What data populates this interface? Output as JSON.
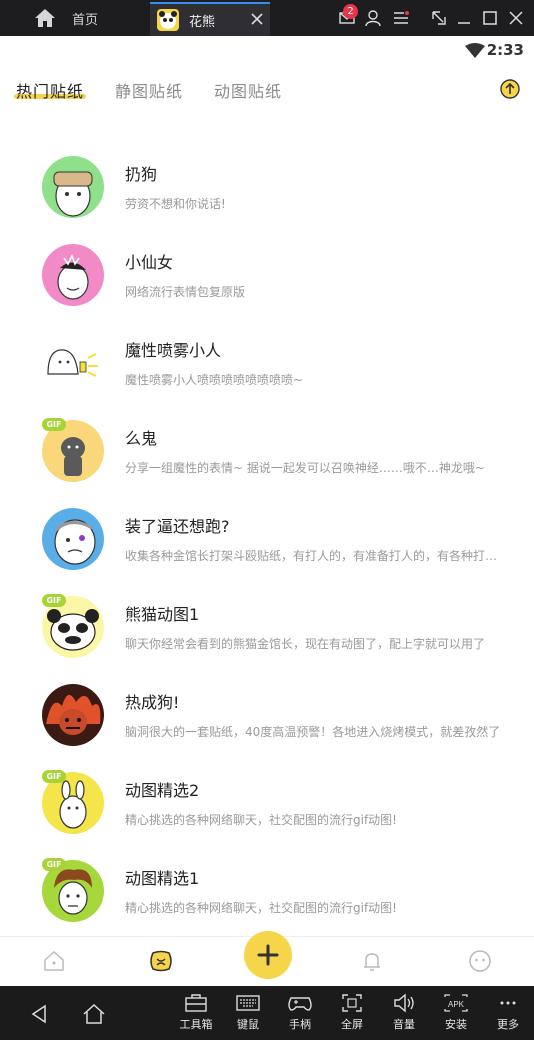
{
  "titlebar": {
    "home_label": "首页",
    "tab_label": "花熊",
    "mail_badge": "2"
  },
  "status": {
    "time": "2:33"
  },
  "tabs": [
    {
      "label": "热门贴纸",
      "active": true
    },
    {
      "label": "静图贴纸",
      "active": false
    },
    {
      "label": "动图贴纸",
      "active": false
    }
  ],
  "items": [
    {
      "name": "扔狗",
      "desc": "劳资不想和你说话!",
      "gif": false,
      "bg": "#8fe08a"
    },
    {
      "name": "小仙女",
      "desc": "网络流行表情包复原版",
      "gif": false,
      "bg": "#f28ac8"
    },
    {
      "name": "魔性喷雾小人",
      "desc": "魔性喷雾小人喷喷喷喷喷喷喷喷~",
      "gif": false,
      "bg": "#ffffff"
    },
    {
      "name": "么鬼",
      "desc": "分享一组魔性的表情~ 据说一起发可以召唤神经……哦不…神龙哦~",
      "gif": true,
      "gif_label": "GIF",
      "bg": "#f9d77a"
    },
    {
      "name": "装了逼还想跑?",
      "desc": "收集各种金馆长打架斗殴贴纸，有打人的，有准备打人的，有各种打人的",
      "gif": false,
      "bg": "#5aaee8"
    },
    {
      "name": "熊猫动图1",
      "desc": "聊天你经常会看到的熊猫金馆长，现在有动图了，配上字就可以用了",
      "gif": true,
      "gif_label": "GIF",
      "bg": "#fbf7a6"
    },
    {
      "name": "热成狗!",
      "desc": "脑洞很大的一套贴纸，40度高温预警！各地进入烧烤模式，就差孜然了",
      "gif": false,
      "bg": "#3a1a12"
    },
    {
      "name": "动图精选2",
      "desc": "精心挑选的各种网络聊天，社交配图的流行gif动图!",
      "gif": true,
      "gif_label": "GIF",
      "bg": "#f4e54a"
    },
    {
      "name": "动图精选1",
      "desc": "精心挑选的各种网络聊天，社交配图的流行gif动图!",
      "gif": true,
      "gif_label": "GIF",
      "bg": "#a6d83c"
    }
  ],
  "sysbar": {
    "items": [
      {
        "label": "工具箱",
        "icon": "toolbox-icon"
      },
      {
        "label": "键鼠",
        "icon": "keyboard-icon"
      },
      {
        "label": "手柄",
        "icon": "gamepad-icon"
      },
      {
        "label": "全屏",
        "icon": "fullscreen-icon"
      },
      {
        "label": "音量",
        "icon": "volume-icon"
      },
      {
        "label": "安装",
        "icon": "apk-install-icon"
      },
      {
        "label": "更多",
        "icon": "more-icon"
      }
    ],
    "apk_text": "APK"
  },
  "colors": {
    "accent": "#f7d54a",
    "gif_badge": "#a7d337",
    "titlebar": "#1d1d1f"
  }
}
